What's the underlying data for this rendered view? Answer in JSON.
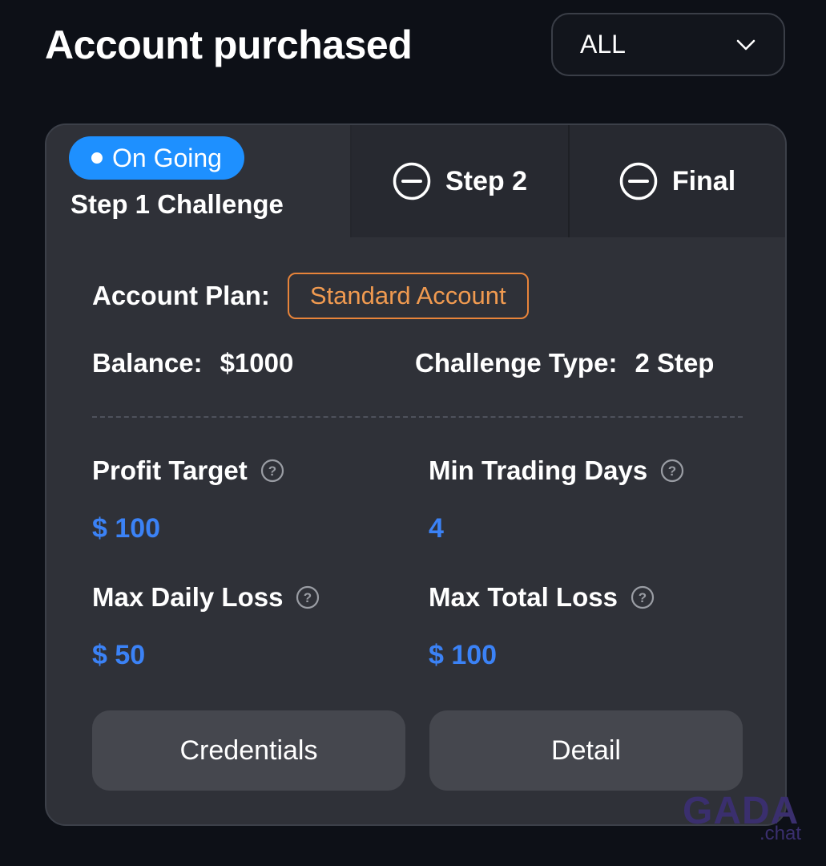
{
  "header": {
    "title": "Account purchased",
    "filter": {
      "selected": "ALL",
      "icon": "chevron-down-icon"
    }
  },
  "card": {
    "steps": {
      "current": {
        "status": "On Going",
        "label": "Step 1 Challenge",
        "status_color": "#1e90ff"
      },
      "step2": {
        "label": "Step 2",
        "icon": "minus-circle-icon"
      },
      "final": {
        "label": "Final",
        "icon": "minus-circle-icon"
      }
    },
    "plan": {
      "label": "Account Plan:",
      "value": "Standard Account",
      "accent": "#e8843a"
    },
    "balance": {
      "label": "Balance:",
      "value": "$1000"
    },
    "challenge_type": {
      "label": "Challenge Type:",
      "value": "2 Step"
    },
    "metrics": {
      "profit_target": {
        "label": "Profit Target",
        "value": "$ 100"
      },
      "min_trading_days": {
        "label": "Min Trading Days",
        "value": "4"
      },
      "max_daily_loss": {
        "label": "Max Daily Loss",
        "value": "$ 50"
      },
      "max_total_loss": {
        "label": "Max Total Loss",
        "value": "$ 100"
      },
      "value_color": "#3b82f6",
      "help_icon": "question-circle-icon"
    },
    "buttons": {
      "credentials": "Credentials",
      "detail": "Detail"
    }
  },
  "watermark": {
    "logo": "GADA",
    "sub": ".chat"
  }
}
